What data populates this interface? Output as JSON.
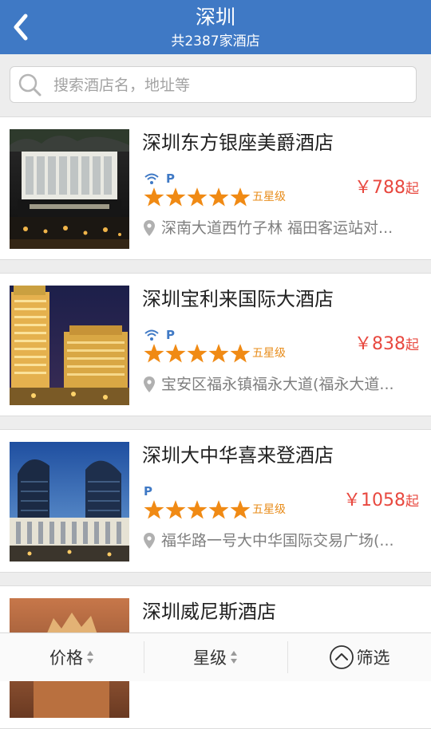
{
  "header": {
    "title": "深圳",
    "subtitle": "共2387家酒店",
    "back_icon": "chevron-left-icon"
  },
  "search": {
    "placeholder": "搜索酒店名，地址等",
    "icon": "search-icon"
  },
  "colors": {
    "brand": "#3f79c5",
    "price": "#e8483f",
    "star": "#f08a14"
  },
  "hotels": [
    {
      "name": "深圳东方银座美爵酒店",
      "wifi": true,
      "parking": "P",
      "stars": 5,
      "grade": "五星级",
      "price": "￥788",
      "price_unit": "起",
      "address": "深南大道西竹子林 福田客运站对..."
    },
    {
      "name": "深圳宝利来国际大酒店",
      "wifi": true,
      "parking": "P",
      "stars": 5,
      "grade": "五星级",
      "price": "￥838",
      "price_unit": "起",
      "address": "宝安区福永镇福永大道(福永大道..."
    },
    {
      "name": "深圳大中华喜来登酒店",
      "wifi": false,
      "parking": "P",
      "stars": 5,
      "grade": "五星级",
      "price": "￥1058",
      "price_unit": "起",
      "address": "福华路一号大中华国际交易广场(..."
    },
    {
      "name": "深圳威尼斯酒店"
    }
  ],
  "bottom_bar": {
    "price_label": "价格",
    "star_label": "星级",
    "filter_label": "筛选"
  }
}
